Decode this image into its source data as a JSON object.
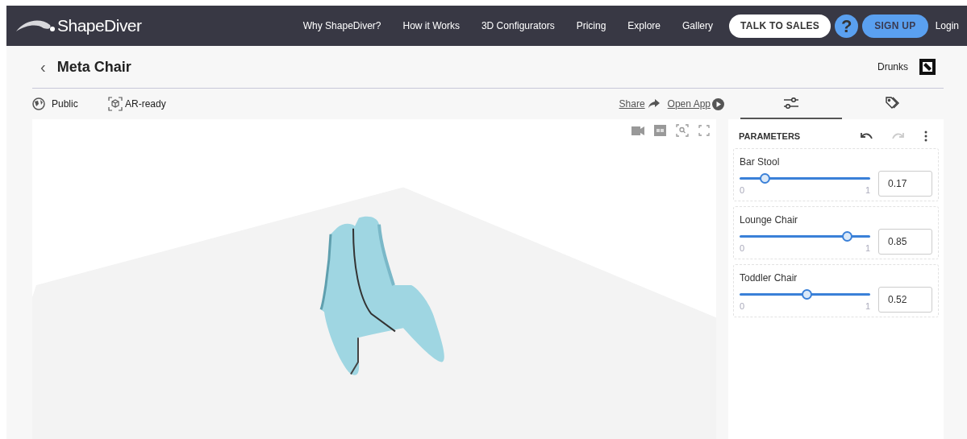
{
  "nav": {
    "logo": "ShapeDiver",
    "links": [
      "Why ShapeDiver?",
      "How it Works",
      "3D Configurators",
      "Pricing",
      "Explore",
      "Gallery"
    ],
    "talk_button": "TALK TO SALES",
    "help": "?",
    "signup_button": "SIGN UP",
    "login": "Login"
  },
  "header": {
    "back": "‹",
    "title": "Meta Chair",
    "user": "Drunks"
  },
  "toolbar": {
    "visibility": "Public",
    "ar": "AR-ready",
    "share": "Share",
    "open_app": "Open App"
  },
  "tabs": [
    {
      "kind": "parameters",
      "selected": true
    },
    {
      "kind": "tags",
      "selected": false
    }
  ],
  "parameters": {
    "title": "PARAMETERS",
    "undo_disabled": false,
    "redo_disabled": true,
    "items": [
      {
        "label": "Bar Stool",
        "min": "0",
        "max": "1",
        "level": 0.17,
        "value": "0.17"
      },
      {
        "label": "Lounge Chair",
        "min": "0",
        "max": "1",
        "level": 0.85,
        "value": "0.85"
      },
      {
        "label": "Toddler Chair",
        "min": "0",
        "max": "1",
        "level": 0.52,
        "value": "0.52"
      }
    ]
  }
}
